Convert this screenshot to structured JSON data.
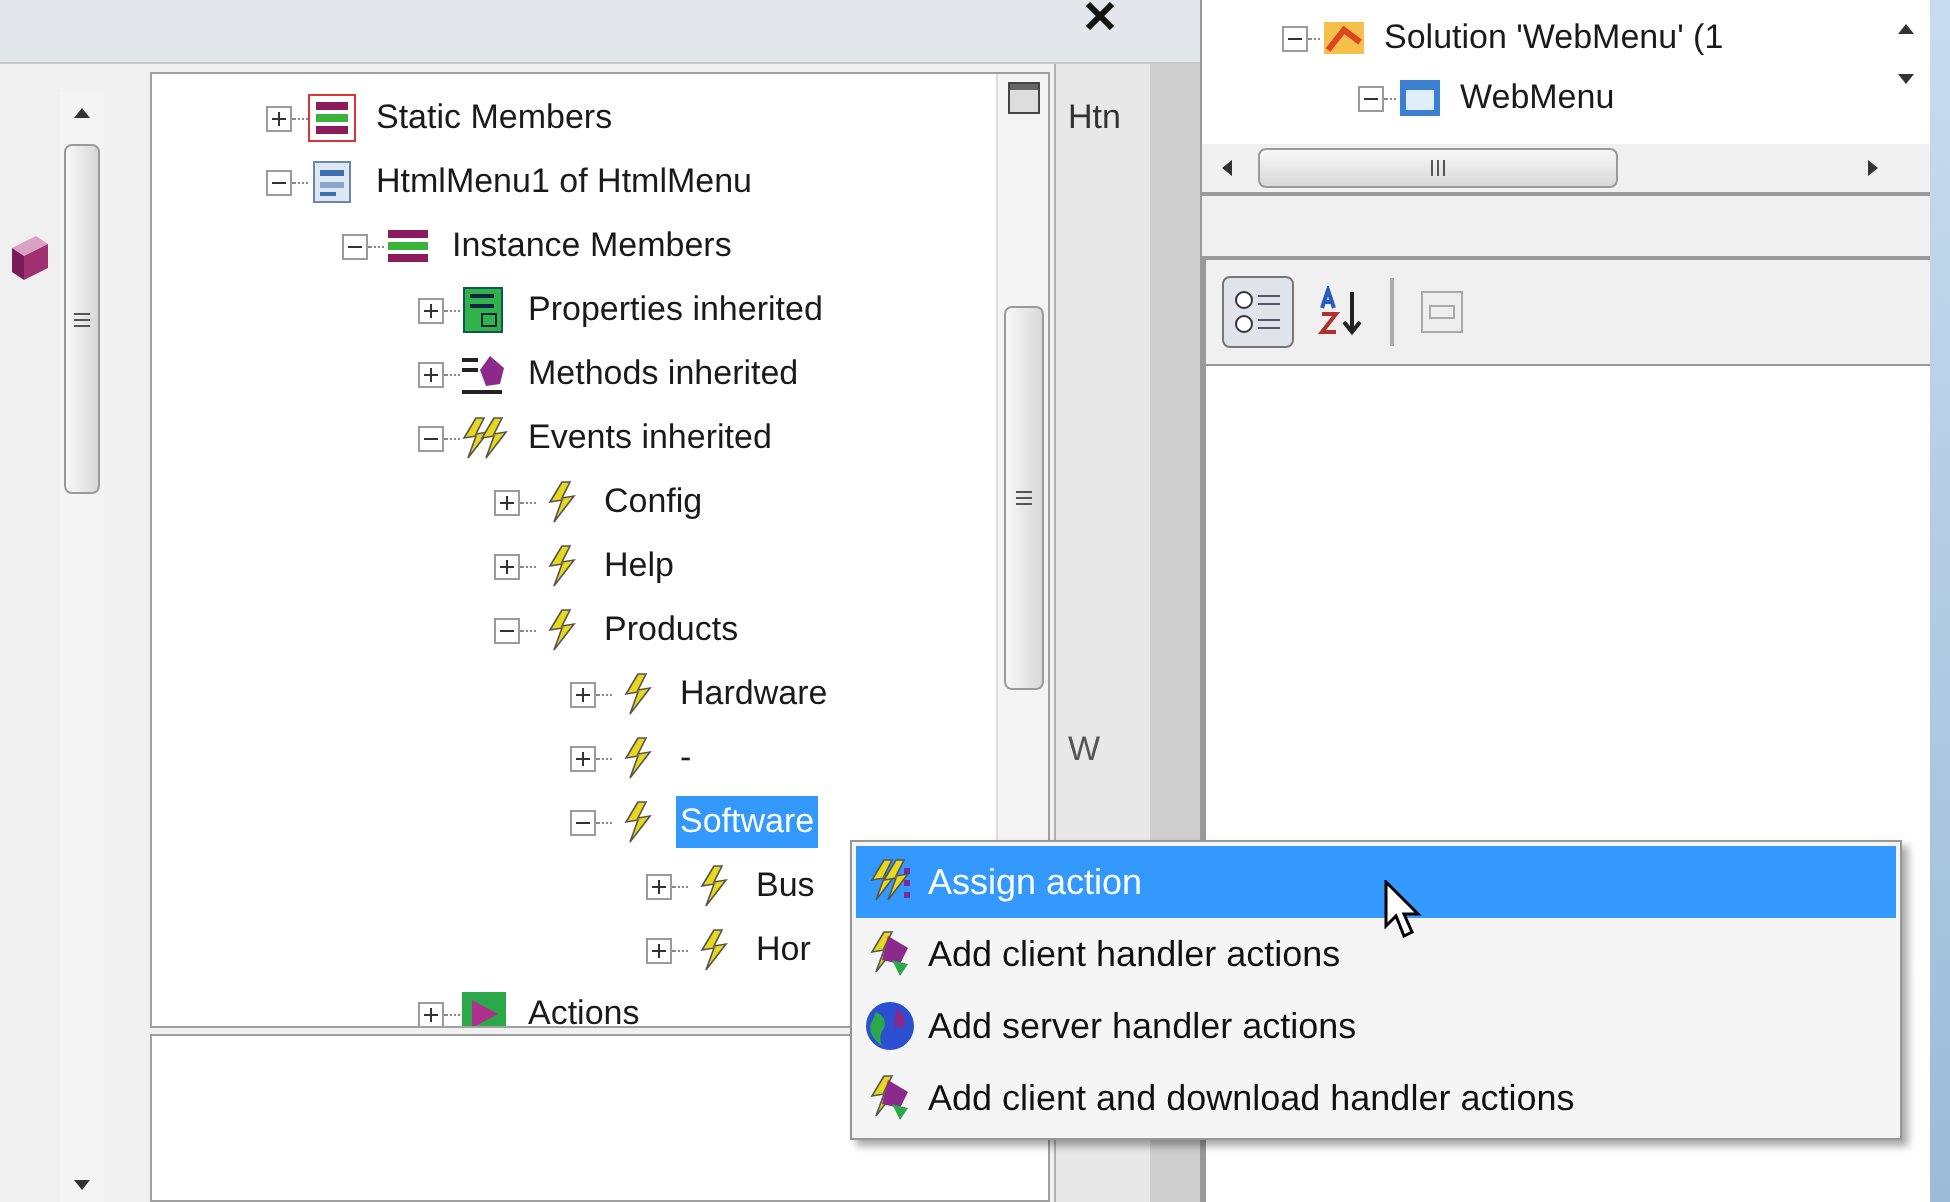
{
  "tree": [
    {
      "label": "Static Members",
      "kind": "class",
      "expanded": false,
      "selected": false
    },
    {
      "label": "HtmlMenu1 of HtmlMenu",
      "kind": "object",
      "expanded": true,
      "selected": false,
      "children": [
        {
          "label": "Instance Members",
          "kind": "members",
          "expanded": true,
          "selected": false,
          "children": [
            {
              "label": "Properties inherited",
              "kind": "properties",
              "expanded": false,
              "selected": false
            },
            {
              "label": "Methods inherited",
              "kind": "methods",
              "expanded": false,
              "selected": false
            },
            {
              "label": "Events inherited",
              "kind": "events",
              "expanded": true,
              "selected": false,
              "children": [
                {
                  "label": "Config",
                  "kind": "event",
                  "expanded": false,
                  "selected": false
                },
                {
                  "label": "Help",
                  "kind": "event",
                  "expanded": false,
                  "selected": false
                },
                {
                  "label": "Products",
                  "kind": "event",
                  "expanded": true,
                  "selected": false,
                  "children": [
                    {
                      "label": "Hardware",
                      "kind": "event",
                      "expanded": false,
                      "selected": false
                    },
                    {
                      "label": "-",
                      "kind": "event",
                      "expanded": false,
                      "selected": false
                    },
                    {
                      "label": "Software",
                      "kind": "event",
                      "expanded": true,
                      "selected": true,
                      "children": [
                        {
                          "label": "Bus",
                          "kind": "event",
                          "expanded": false,
                          "selected": false
                        },
                        {
                          "label": "Hor",
                          "kind": "event",
                          "expanded": false,
                          "selected": false
                        }
                      ]
                    }
                  ]
                }
              ]
            },
            {
              "label": "Actions",
              "kind": "actions",
              "expanded": false,
              "selected": false
            }
          ]
        }
      ]
    }
  ],
  "side_panel": {
    "top_text": "Htn",
    "lower_text": "W"
  },
  "context_menu": [
    {
      "label": "Assign action",
      "kind": "assign",
      "selected": true
    },
    {
      "label": "Add client handler actions",
      "kind": "client",
      "selected": false
    },
    {
      "label": "Add server handler actions",
      "kind": "server",
      "selected": false
    },
    {
      "label": "Add client and download handler actions",
      "kind": "client_download",
      "selected": false
    }
  ],
  "solution_explorer": [
    {
      "label": "Solution 'WebMenu' (1",
      "kind": "solution",
      "expanded": true
    },
    {
      "label": "WebMenu",
      "kind": "project",
      "expanded": true
    }
  ],
  "properties_toolbar": [
    {
      "kind": "categorized",
      "selected": true
    },
    {
      "kind": "alphabetical",
      "selected": false
    },
    {
      "kind": "separator",
      "selected": false
    },
    {
      "kind": "pages",
      "selected": false
    }
  ]
}
